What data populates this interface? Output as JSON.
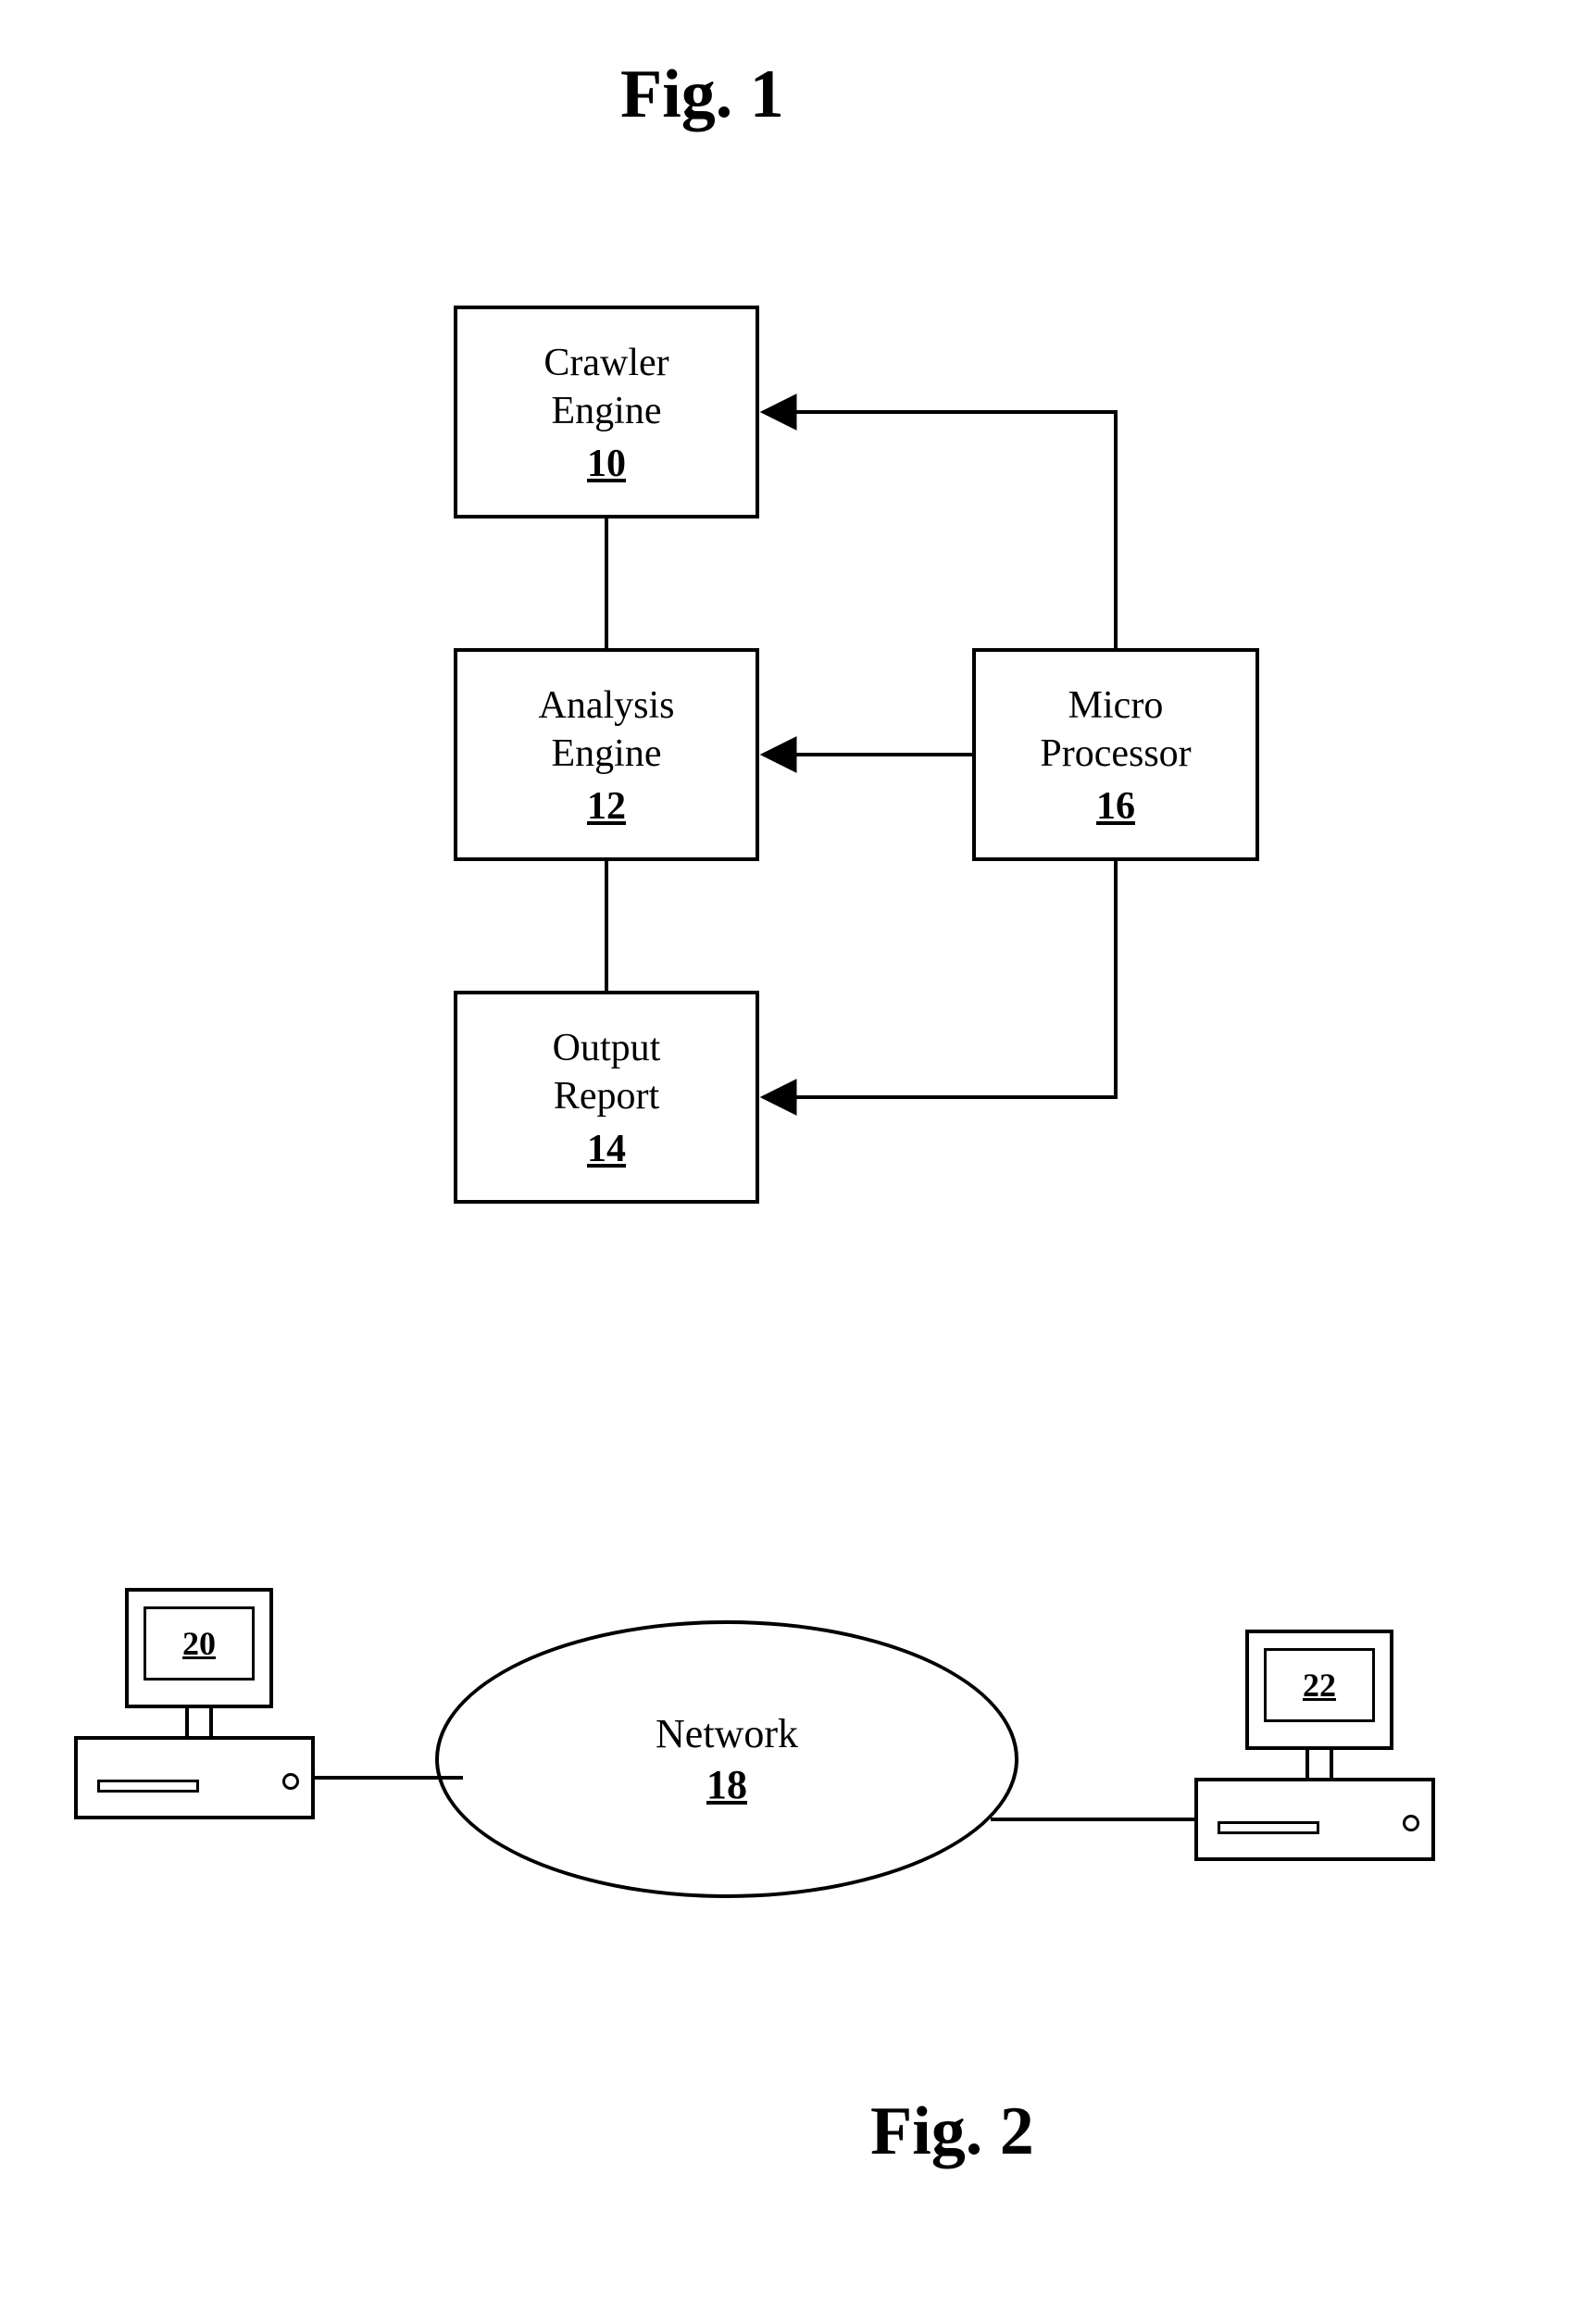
{
  "fig1": {
    "title": "Fig. 1",
    "boxes": {
      "crawler": {
        "label": "Crawler\nEngine",
        "ref": "10"
      },
      "analysis": {
        "label": "Analysis\nEngine",
        "ref": "12"
      },
      "output": {
        "label": "Output\nReport",
        "ref": "14"
      },
      "processor": {
        "label": "Micro\nProcessor",
        "ref": "16"
      }
    }
  },
  "fig2": {
    "title": "Fig. 2",
    "network": {
      "label": "Network",
      "ref": "18"
    },
    "leftComputer": {
      "ref": "20"
    },
    "rightComputer": {
      "ref": "22"
    }
  }
}
